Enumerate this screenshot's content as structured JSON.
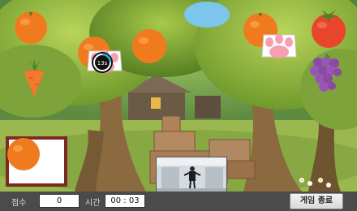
{
  "scene": {
    "falling_items": [
      {
        "name": "orange-fruit-1",
        "kind": "orange"
      },
      {
        "name": "orange-fruit-2",
        "kind": "orange"
      },
      {
        "name": "orange-fruit-3",
        "kind": "orange"
      },
      {
        "name": "orange-fruit-4",
        "kind": "orange"
      },
      {
        "name": "tomato-fruit",
        "kind": "tomato"
      },
      {
        "name": "carrot-vegetable",
        "kind": "carrot"
      },
      {
        "name": "grape-bunch",
        "kind": "grapes"
      },
      {
        "name": "paw-cursor-left",
        "kind": "paw"
      },
      {
        "name": "paw-cursor-right",
        "kind": "paw"
      }
    ],
    "countdown_badge": "13s",
    "colors": {
      "orange": "#f07b1e",
      "tomato": "#e8452a",
      "grape": "#8a4aa6",
      "paw_pad": "#f5a0b0",
      "sky": "#4ab0e8",
      "grass": "#8cb84a"
    }
  },
  "target": {
    "label": "target-fruit",
    "kind": "orange"
  },
  "hud": {
    "score_label": "점수",
    "score_value": "0",
    "time_label": "시간",
    "time_value": "00 : 03",
    "end_button_label": "게임 종료"
  }
}
